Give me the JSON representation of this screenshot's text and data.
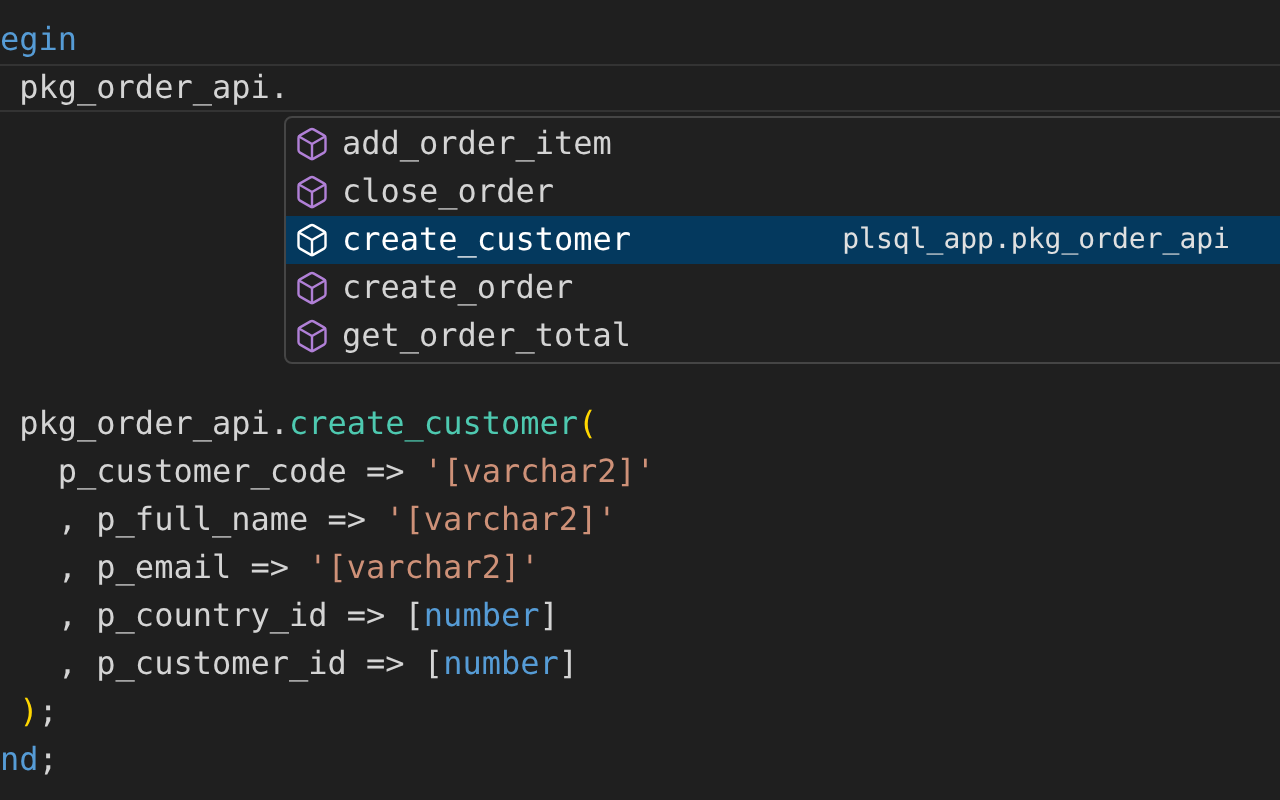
{
  "editor": {
    "lines_above": [
      [
        {
          "kind": "keyword",
          "text": "egin"
        }
      ],
      [
        {
          "kind": "plain",
          "text": " pkg_order_api."
        }
      ]
    ],
    "lines_below": [
      [
        {
          "kind": "plain",
          "text": " pkg_order_api."
        },
        {
          "kind": "function",
          "text": "create_customer"
        },
        {
          "kind": "paren",
          "text": "("
        }
      ],
      [
        {
          "kind": "plain",
          "text": "   p_customer_code => "
        },
        {
          "kind": "string",
          "text": "'[varchar2]'"
        }
      ],
      [
        {
          "kind": "plain",
          "text": "   , p_full_name => "
        },
        {
          "kind": "string",
          "text": "'[varchar2]'"
        }
      ],
      [
        {
          "kind": "plain",
          "text": "   , p_email => "
        },
        {
          "kind": "string",
          "text": "'[varchar2]'"
        }
      ],
      [
        {
          "kind": "plain",
          "text": "   , p_country_id => ["
        },
        {
          "kind": "type",
          "text": "number"
        },
        {
          "kind": "plain",
          "text": "]"
        }
      ],
      [
        {
          "kind": "plain",
          "text": "   , p_customer_id => ["
        },
        {
          "kind": "type",
          "text": "number"
        },
        {
          "kind": "plain",
          "text": "]"
        }
      ],
      [
        {
          "kind": "paren",
          "text": " )"
        },
        {
          "kind": "plain",
          "text": ";"
        }
      ],
      [
        {
          "kind": "keyword",
          "text": "nd"
        },
        {
          "kind": "plain",
          "text": ";"
        }
      ]
    ]
  },
  "suggestions": [
    {
      "label": "add_order_item",
      "selected": false
    },
    {
      "label": "close_order",
      "selected": false
    },
    {
      "label": "create_customer",
      "selected": true,
      "detail": "plsql_app.pkg_order_api"
    },
    {
      "label": "create_order",
      "selected": false
    },
    {
      "label": "get_order_total",
      "selected": false
    }
  ]
}
